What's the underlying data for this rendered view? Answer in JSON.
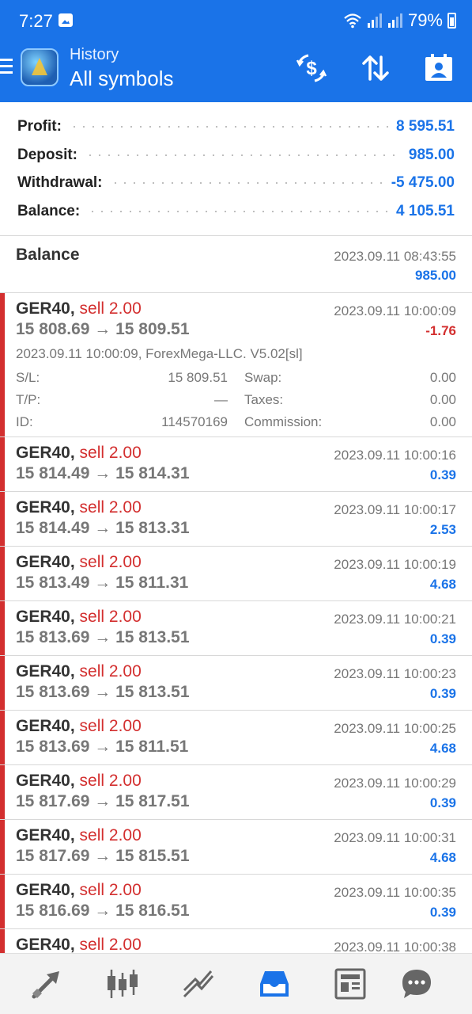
{
  "status": {
    "time": "7:27",
    "battery": "79%"
  },
  "header": {
    "subtitle": "History",
    "title": "All symbols"
  },
  "summary": [
    {
      "label": "Profit:",
      "value": "8 595.51"
    },
    {
      "label": "Deposit:",
      "value": "985.00"
    },
    {
      "label": "Withdrawal:",
      "value": "-5 475.00"
    },
    {
      "label": "Balance:",
      "value": "4 105.51"
    }
  ],
  "balance_entry": {
    "title": "Balance",
    "time": "2023.09.11 08:43:55",
    "amount": "985.00"
  },
  "expanded_deal": {
    "symbol": "GER40,",
    "type": "sell 2.00",
    "prices": "15 808.69 → 15 809.51",
    "time": "2023.09.11 10:00:09",
    "profit": "-1.76",
    "comment": "2023.09.11 10:00:09, ForexMega-LLC. V5.02[sl]",
    "sl_label": "S/L:",
    "sl_value": "15 809.51",
    "tp_label": "T/P:",
    "tp_value": "—",
    "id_label": "ID:",
    "id_value": "114570169",
    "swap_label": "Swap:",
    "swap_value": "0.00",
    "taxes_label": "Taxes:",
    "taxes_value": "0.00",
    "commission_label": "Commission:",
    "commission_value": "0.00"
  },
  "deals": [
    {
      "symbol": "GER40,",
      "type": "sell 2.00",
      "prices": "15 814.49 → 15 814.31",
      "time": "2023.09.11 10:00:16",
      "profit": "0.39"
    },
    {
      "symbol": "GER40,",
      "type": "sell 2.00",
      "prices": "15 814.49 → 15 813.31",
      "time": "2023.09.11 10:00:17",
      "profit": "2.53"
    },
    {
      "symbol": "GER40,",
      "type": "sell 2.00",
      "prices": "15 813.49 → 15 811.31",
      "time": "2023.09.11 10:00:19",
      "profit": "4.68"
    },
    {
      "symbol": "GER40,",
      "type": "sell 2.00",
      "prices": "15 813.69 → 15 813.51",
      "time": "2023.09.11 10:00:21",
      "profit": "0.39"
    },
    {
      "symbol": "GER40,",
      "type": "sell 2.00",
      "prices": "15 813.69 → 15 813.51",
      "time": "2023.09.11 10:00:23",
      "profit": "0.39"
    },
    {
      "symbol": "GER40,",
      "type": "sell 2.00",
      "prices": "15 813.69 → 15 811.51",
      "time": "2023.09.11 10:00:25",
      "profit": "4.68"
    },
    {
      "symbol": "GER40,",
      "type": "sell 2.00",
      "prices": "15 817.69 → 15 817.51",
      "time": "2023.09.11 10:00:29",
      "profit": "0.39"
    },
    {
      "symbol": "GER40,",
      "type": "sell 2.00",
      "prices": "15 817.69 → 15 815.51",
      "time": "2023.09.11 10:00:31",
      "profit": "4.68"
    },
    {
      "symbol": "GER40,",
      "type": "sell 2.00",
      "prices": "15 816.69 → 15 816.51",
      "time": "2023.09.11 10:00:35",
      "profit": "0.39"
    },
    {
      "symbol": "GER40,",
      "type": "sell 2.00",
      "prices": "",
      "time": "2023.09.11 10:00:38",
      "profit": ""
    }
  ],
  "icons": {
    "header": [
      "dollar-exchange-icon",
      "sort-icon",
      "contact-card-icon"
    ],
    "nav": [
      "trade-arrows-icon",
      "candlestick-icon",
      "chart-trend-icon",
      "history-inbox-icon",
      "news-icon",
      "chat-icon"
    ]
  },
  "colors": {
    "accent": "#1a73e8",
    "sell": "#d32f2f"
  }
}
